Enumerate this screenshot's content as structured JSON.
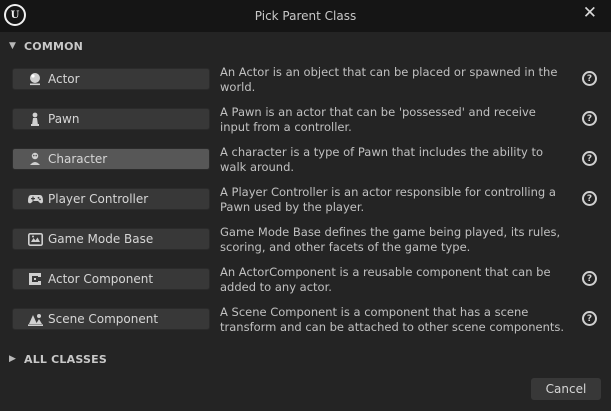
{
  "window": {
    "title": "Pick Parent Class",
    "close_symbol": "✕",
    "logo_letter": "U"
  },
  "sections": {
    "common": {
      "label": "COMMON",
      "expanded": true
    },
    "all_classes": {
      "label": "ALL CLASSES",
      "expanded": false
    }
  },
  "classes": [
    {
      "label": "Actor",
      "icon": "actor-sphere-icon",
      "description": "An Actor is an object that can be placed or spawned in the world.",
      "selected": false
    },
    {
      "label": "Pawn",
      "icon": "pawn-icon",
      "description": "A Pawn is an actor that can be 'possessed' and receive input from a controller.",
      "selected": false
    },
    {
      "label": "Character",
      "icon": "character-icon",
      "description": "A character is a type of Pawn that includes the ability to walk around.",
      "selected": true
    },
    {
      "label": "Player Controller",
      "icon": "gamepad-icon",
      "description": "A Player Controller is an actor responsible for controlling a Pawn used by the player.",
      "selected": false
    },
    {
      "label": "Game Mode Base",
      "icon": "game-mode-icon",
      "description": "Game Mode Base defines the game being played, its rules, scoring, and other facets of the game type.",
      "selected": false
    },
    {
      "label": "Actor Component",
      "icon": "actor-component-icon",
      "description": "An ActorComponent is a reusable component that can be added to any actor.",
      "selected": false
    },
    {
      "label": "Scene Component",
      "icon": "scene-component-icon",
      "description": "A Scene Component is a component that has a scene transform and can be attached to other scene components.",
      "selected": false
    }
  ],
  "help_symbol": "?",
  "footer": {
    "cancel_label": "Cancel"
  },
  "colors": {
    "title_bar": "#151515",
    "panel": "#242424",
    "button": "#383838",
    "button_selected": "#575757"
  }
}
